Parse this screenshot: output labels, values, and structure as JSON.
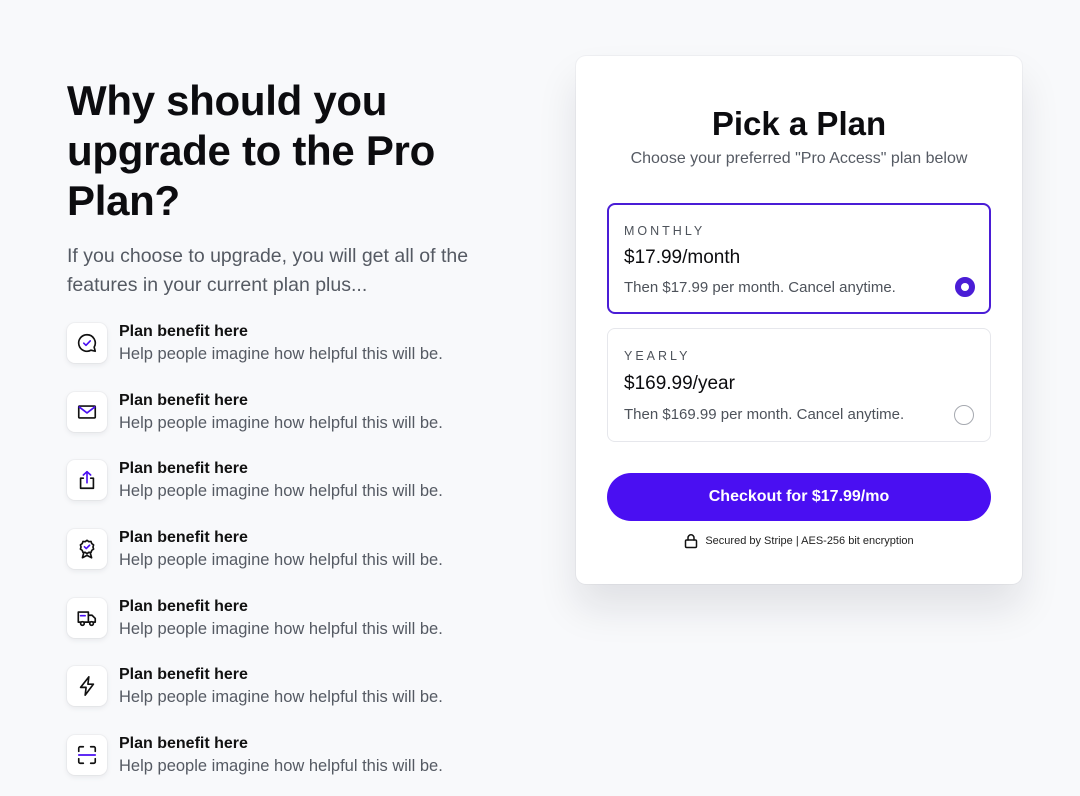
{
  "headline": "Why should you upgrade to the Pro Plan?",
  "intro": "If you choose to upgrade, you will get all of the features in your current plan plus...",
  "benefits": [
    {
      "icon": "message-check-icon",
      "title": "Plan benefit here",
      "desc": "Help people imagine how helpful this will be."
    },
    {
      "icon": "mail-icon",
      "title": "Plan benefit here",
      "desc": "Help people imagine how helpful this will be."
    },
    {
      "icon": "share-icon",
      "title": "Plan benefit here",
      "desc": "Help people imagine how helpful this will be."
    },
    {
      "icon": "award-icon",
      "title": "Plan benefit here",
      "desc": "Help people imagine how helpful this will be."
    },
    {
      "icon": "truck-icon",
      "title": "Plan benefit here",
      "desc": "Help people imagine how helpful this will be."
    },
    {
      "icon": "lightning-icon",
      "title": "Plan benefit here",
      "desc": "Help people imagine how helpful this will be."
    },
    {
      "icon": "scan-icon",
      "title": "Plan benefit here",
      "desc": "Help people imagine how helpful this will be."
    }
  ],
  "card": {
    "title": "Pick a Plan",
    "subtitle": "Choose your preferred \"Pro Access\" plan below",
    "plans": [
      {
        "label": "MONTHLY",
        "price": "$17.99/month",
        "note": "Then $17.99 per month. Cancel anytime.",
        "selected": true
      },
      {
        "label": "YEARLY",
        "price": "$169.99/year",
        "note": "Then $169.99 per month. Cancel anytime.",
        "selected": false
      }
    ],
    "checkout_label": "Checkout for $17.99/mo",
    "secure_text": "Secured by Stripe | AES-256 bit encryption"
  },
  "colors": {
    "accent": "#4a0ff2",
    "selected_border": "#4a1dd6",
    "background": "#f8f9fb"
  }
}
